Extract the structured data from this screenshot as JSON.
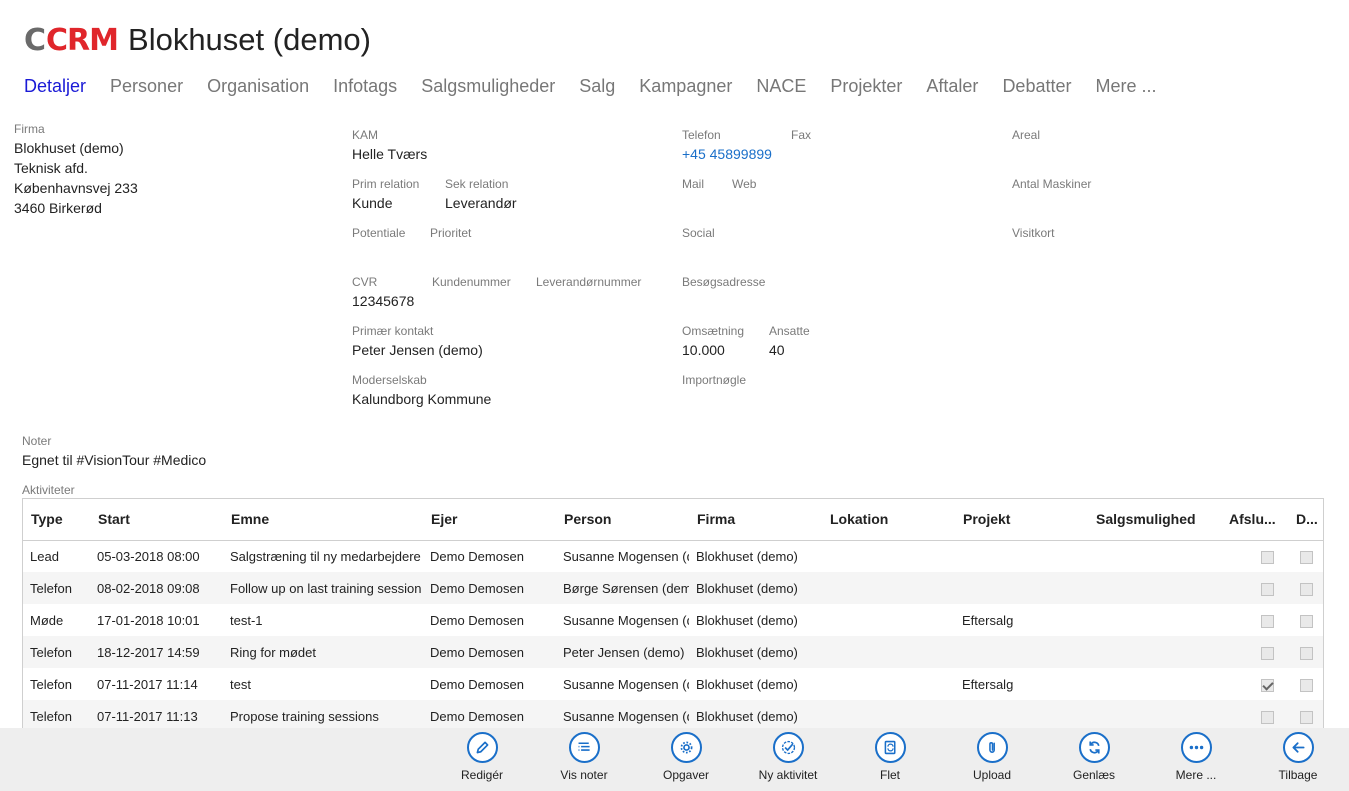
{
  "header": {
    "logo_c": "C",
    "logo_crm": "CRM",
    "title": "Blokhuset (demo)"
  },
  "tabs": [
    "Detaljer",
    "Personer",
    "Organisation",
    "Infotags",
    "Salgsmuligheder",
    "Salg",
    "Kampagner",
    "NACE",
    "Projekter",
    "Aftaler",
    "Debatter",
    "Mere ..."
  ],
  "firma": {
    "label": "Firma",
    "lines": [
      "Blokhuset (demo)",
      "Teknisk afd.",
      "Københavnsvej 233",
      "3460 Birkerød"
    ]
  },
  "fields": {
    "kam": {
      "label": "KAM",
      "value": "Helle Tværs"
    },
    "prim_relation": {
      "label": "Prim relation",
      "value": "Kunde"
    },
    "sek_relation": {
      "label": "Sek relation",
      "value": "Leverandør"
    },
    "potentiale": {
      "label": "Potentiale"
    },
    "prioritet": {
      "label": "Prioritet"
    },
    "cvr": {
      "label": "CVR",
      "value": "12345678"
    },
    "kundenummer": {
      "label": "Kundenummer"
    },
    "leverandornummer": {
      "label": "Leverandørnummer"
    },
    "primaer_kontakt": {
      "label": "Primær kontakt",
      "value": "Peter Jensen (demo)"
    },
    "moderselskab": {
      "label": "Moderselskab",
      "value": "Kalundborg Kommune"
    },
    "telefon": {
      "label": "Telefon",
      "value": "+45 45899899"
    },
    "fax": {
      "label": "Fax"
    },
    "mail": {
      "label": "Mail"
    },
    "web": {
      "label": "Web"
    },
    "social": {
      "label": "Social"
    },
    "besogsadresse": {
      "label": "Besøgsadresse"
    },
    "omsaetning": {
      "label": "Omsætning",
      "value": "10.000"
    },
    "ansatte": {
      "label": "Ansatte",
      "value": "40"
    },
    "importnogle": {
      "label": "Importnøgle"
    },
    "areal": {
      "label": "Areal"
    },
    "antal_maskiner": {
      "label": "Antal Maskiner"
    },
    "visitkort": {
      "label": "Visitkort"
    }
  },
  "noter": {
    "label": "Noter",
    "value": "Egnet til #VisionTour #Medico"
  },
  "aktiviteter": {
    "label": "Aktiviteter",
    "columns": [
      "Type",
      "Start",
      "Emne",
      "Ejer",
      "Person",
      "Firma",
      "Lokation",
      "Projekt",
      "Salgsmulighed",
      "Afslu...",
      "D..."
    ],
    "rows": [
      {
        "type": "Lead",
        "start": "05-03-2018 08:00",
        "emne": "Salgstræning til ny medarbejdere",
        "ejer": "Demo Demosen",
        "person": "Susanne Mogensen (demo)",
        "firma": "Blokhuset (demo)",
        "lokation": "",
        "projekt": "",
        "salgsmulighed": "",
        "afsluttet": false,
        "d": false
      },
      {
        "type": "Telefon",
        "start": "08-02-2018 09:08",
        "emne": "Follow up on last training session",
        "ejer": "Demo Demosen",
        "person": "Børge Sørensen (demo)",
        "firma": "Blokhuset (demo)",
        "lokation": "",
        "projekt": "",
        "salgsmulighed": "",
        "afsluttet": false,
        "d": false
      },
      {
        "type": "Møde",
        "start": "17-01-2018 10:01",
        "emne": "test-1",
        "ejer": "Demo Demosen",
        "person": "Susanne Mogensen (demo)",
        "firma": "Blokhuset (demo)",
        "lokation": "",
        "projekt": "Eftersalg",
        "salgsmulighed": "",
        "afsluttet": false,
        "d": false
      },
      {
        "type": "Telefon",
        "start": "18-12-2017 14:59",
        "emne": "Ring for mødet",
        "ejer": "Demo Demosen",
        "person": "Peter Jensen (demo)",
        "firma": "Blokhuset (demo)",
        "lokation": "",
        "projekt": "",
        "salgsmulighed": "",
        "afsluttet": false,
        "d": false
      },
      {
        "type": "Telefon",
        "start": "07-11-2017 11:14",
        "emne": "test",
        "ejer": "Demo Demosen",
        "person": "Susanne Mogensen (demo)",
        "firma": "Blokhuset (demo)",
        "lokation": "",
        "projekt": "Eftersalg",
        "salgsmulighed": "",
        "afsluttet": true,
        "d": false
      },
      {
        "type": "Telefon",
        "start": "07-11-2017 11:13",
        "emne": "Propose training sessions",
        "ejer": "Demo Demosen",
        "person": "Susanne Mogensen (demo)",
        "firma": "Blokhuset (demo)",
        "lokation": "",
        "projekt": "",
        "salgsmulighed": "",
        "afsluttet": false,
        "d": false
      }
    ]
  },
  "toolbar": [
    {
      "name": "rediger",
      "label": "Redigér",
      "icon": "pencil-icon"
    },
    {
      "name": "vis-noter",
      "label": "Vis noter",
      "icon": "notes-list-icon"
    },
    {
      "name": "opgaver",
      "label": "Opgaver",
      "icon": "gear-icon"
    },
    {
      "name": "ny-aktivitet",
      "label": "Ny aktivitet",
      "icon": "check-badge-icon"
    },
    {
      "name": "flet",
      "label": "Flet",
      "icon": "merge-document-icon"
    },
    {
      "name": "upload",
      "label": "Upload",
      "icon": "paperclip-icon"
    },
    {
      "name": "genlaes",
      "label": "Genlæs",
      "icon": "refresh-icon"
    },
    {
      "name": "mere",
      "label": "Mere ...",
      "icon": "more-dots-icon"
    },
    {
      "name": "tilbage",
      "label": "Tilbage",
      "icon": "arrow-left-icon"
    }
  ]
}
